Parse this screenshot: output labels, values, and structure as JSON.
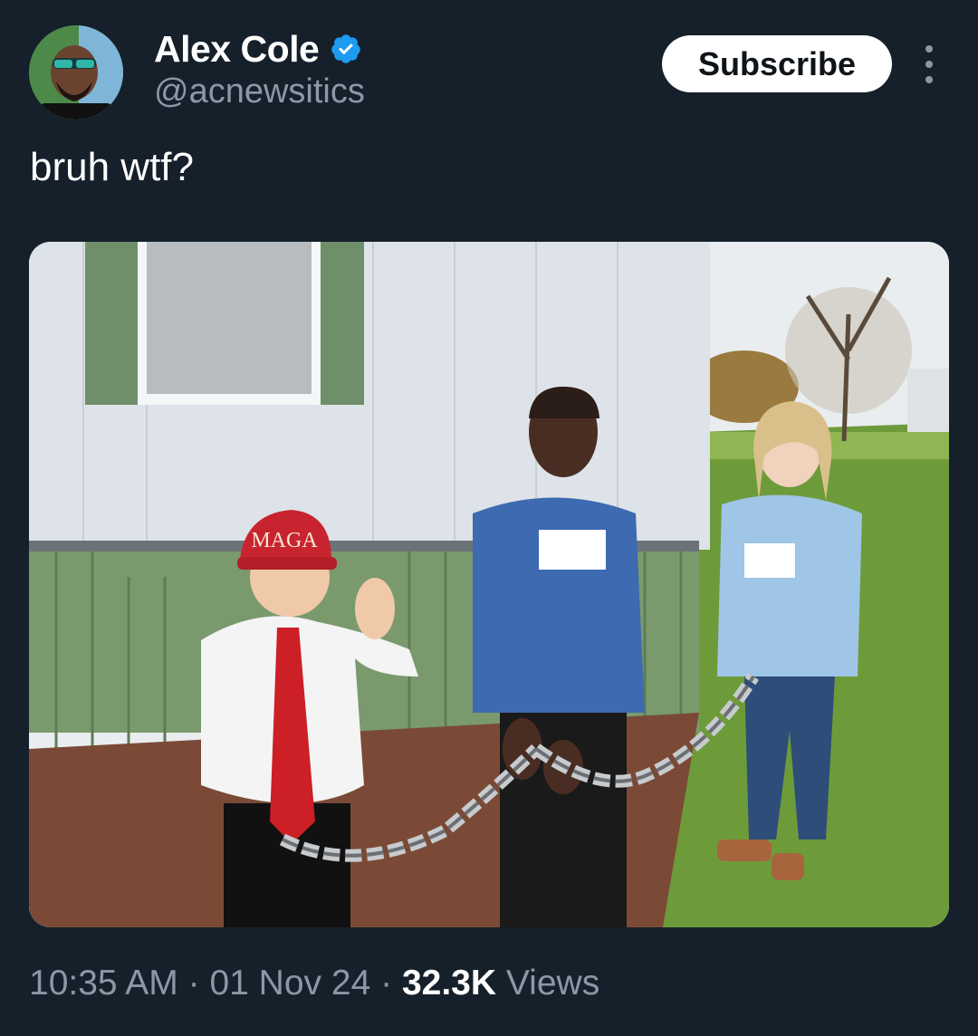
{
  "author": {
    "display_name": "Alex Cole",
    "handle": "@acnewsitics",
    "verified": true,
    "avatar_icon": "profile-photo-icon",
    "verified_icon": "verified-badge-icon",
    "verified_color": "#1d9bf0"
  },
  "actions": {
    "subscribe_label": "Subscribe",
    "more_icon": "more-vertical-icon"
  },
  "tweet": {
    "text": "bruh wtf?"
  },
  "media": {
    "description": "photo",
    "hat_text": "MAGA"
  },
  "meta": {
    "time": "10:35 AM",
    "separator": "·",
    "date": "01 Nov 24",
    "views_count": "32.3K",
    "views_label": "Views"
  },
  "colors": {
    "background": "#15202b",
    "secondary_text": "#8b98a5",
    "primary_text": "#ffffff"
  }
}
